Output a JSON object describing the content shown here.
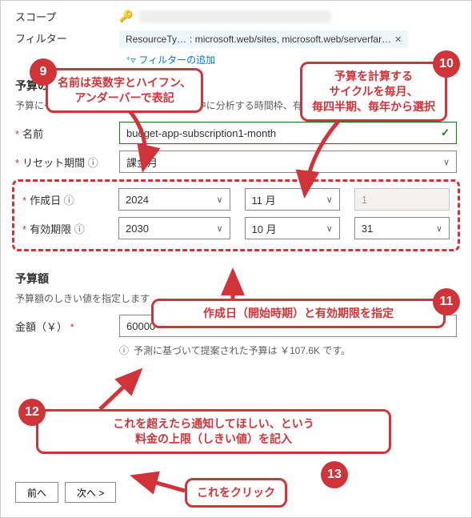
{
  "scope": {
    "label": "スコープ"
  },
  "filter": {
    "label": "フィルター",
    "pill_prefix": "ResourceTy…",
    "pill_value": ": microsoft.web/sites, microsoft.web/serverfar…",
    "add_label": "フィルターの追加"
  },
  "details": {
    "title": "予算の詳細",
    "help": "予算に一意の名前を付けます。各評価期間中に分析する時間枠、有効期限、金額を選択します。",
    "name_label": "名前",
    "name_value": "budget-app-subscription1-month",
    "reset_label": "リセット期間",
    "reset_value": "課金月",
    "created_label": "作成日",
    "created_year": "2024",
    "created_month": "11 月",
    "created_day": "1",
    "expiry_label": "有効期限",
    "expiry_year": "2030",
    "expiry_month": "10 月",
    "expiry_day": "31"
  },
  "budget": {
    "title": "予算額",
    "help": "予算額のしきい値を指定します",
    "amount_label": "金額（￥）",
    "amount_value": "60000",
    "suggestion": "予測に基づいて提案された予算は ￥107.6K です。"
  },
  "buttons": {
    "prev": "前へ",
    "next": "次へ >"
  },
  "callouts": {
    "c9": "名前は英数字とハイフン、\nアンダーバーで表記",
    "c10": "予算を計算する\nサイクルを毎月、\n毎四半期、毎年から選択",
    "c11": "作成日（開始時期）と有効期限を指定",
    "c12": "これを超えたら通知してほしい、という\n料金の上限（しきい値）を記入",
    "c13": "これをクリック"
  }
}
